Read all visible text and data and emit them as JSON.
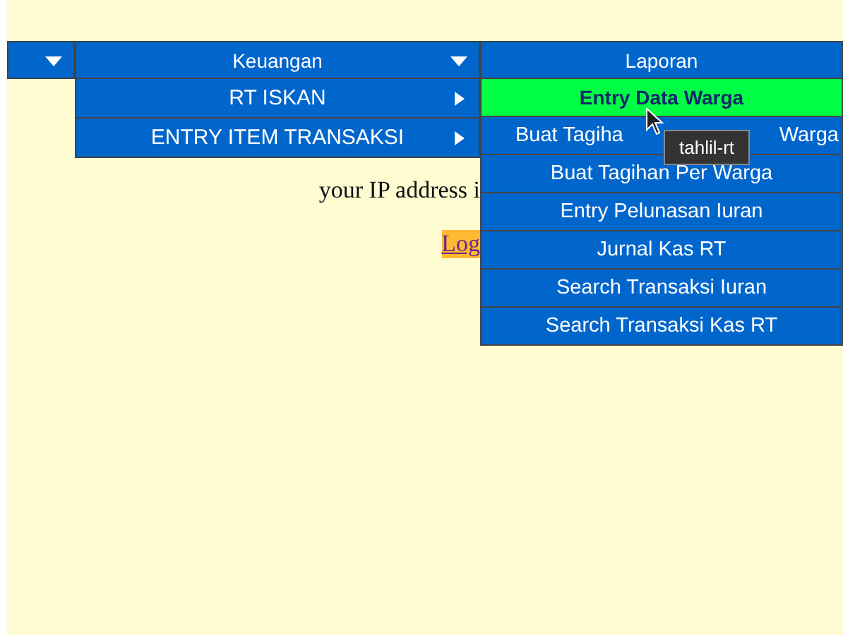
{
  "menu_bar": {
    "items": [
      {
        "has_caret": true
      },
      {
        "label": "Keuangan",
        "has_caret": true
      },
      {
        "label": "Laporan",
        "has_caret": false
      }
    ]
  },
  "keuangan_menu": [
    {
      "label": "RT ISKAN",
      "has_submenu": true,
      "selected": false
    },
    {
      "label": "ENTRY ITEM TRANSAKSI",
      "has_submenu": true,
      "selected": false
    }
  ],
  "laporan_menu": [
    {
      "parts": [
        "Entry Data Warga"
      ],
      "selected": true
    },
    {
      "parts": [
        "Buat Tagiha",
        "Warga"
      ],
      "selected": false
    },
    {
      "parts": [
        "Buat Tagihan Per Warga"
      ],
      "selected": false
    },
    {
      "parts": [
        "Entry Pelunasan Iuran"
      ],
      "selected": false
    },
    {
      "parts": [
        "Jurnal Kas RT"
      ],
      "selected": false
    },
    {
      "parts": [
        "Search Transaksi Iuran"
      ],
      "selected": false
    },
    {
      "parts": [
        "Search Transaksi Kas RT"
      ],
      "selected": false
    }
  ],
  "tooltip": "tahlil-rt",
  "content": {
    "ip_text": "your IP address i",
    "link": "Log"
  }
}
